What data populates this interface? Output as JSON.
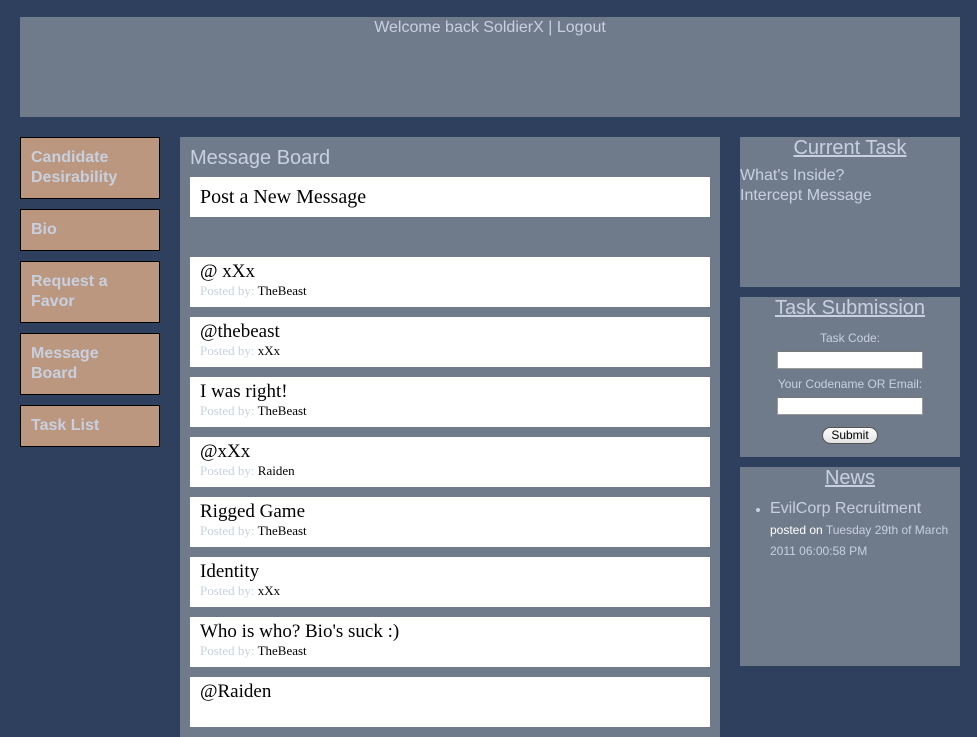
{
  "header": {
    "welcome_text": "Welcome back SoldierX",
    "separator": "|",
    "logout_label": "Logout"
  },
  "nav": {
    "items": [
      {
        "label": "Candidate Desirability"
      },
      {
        "label": "Bio"
      },
      {
        "label": "Request a Favor"
      },
      {
        "label": "Message Board"
      },
      {
        "label": "Task List"
      }
    ]
  },
  "main": {
    "title": "Message Board",
    "post_new_label": "Post a New Message",
    "posted_by_label": "Posted by:",
    "messages": [
      {
        "title": "@ xXx",
        "author": "TheBeast"
      },
      {
        "title": "@thebeast",
        "author": "xXx"
      },
      {
        "title": "I was right!",
        "author": "TheBeast"
      },
      {
        "title": "@xXx",
        "author": "Raiden"
      },
      {
        "title": "Rigged Game",
        "author": "TheBeast"
      },
      {
        "title": "Identity",
        "author": "xXx"
      },
      {
        "title": "Who is who? Bio's suck :)",
        "author": "TheBeast"
      },
      {
        "title": "@Raiden",
        "author": ""
      }
    ]
  },
  "current_task": {
    "title": "Current Task",
    "tasks": [
      "What's Inside?",
      "Intercept Message"
    ]
  },
  "task_submission": {
    "title": "Task Submission",
    "task_code_label": "Task Code:",
    "task_code_value": "",
    "codename_label": "Your Codename OR Email:",
    "codename_value": "",
    "submit_label": "Submit"
  },
  "news": {
    "title": "News",
    "items": [
      {
        "headline": "EvilCorp Recruitment",
        "posted_on_label": "posted on",
        "date": "Tuesday 29th of March 2011 06:00:58 PM"
      }
    ]
  },
  "colors": {
    "background": "#2e405e",
    "panel": "#6f7b8b",
    "nav_button": "#bb977f",
    "text_light": "#c8d0e0"
  }
}
